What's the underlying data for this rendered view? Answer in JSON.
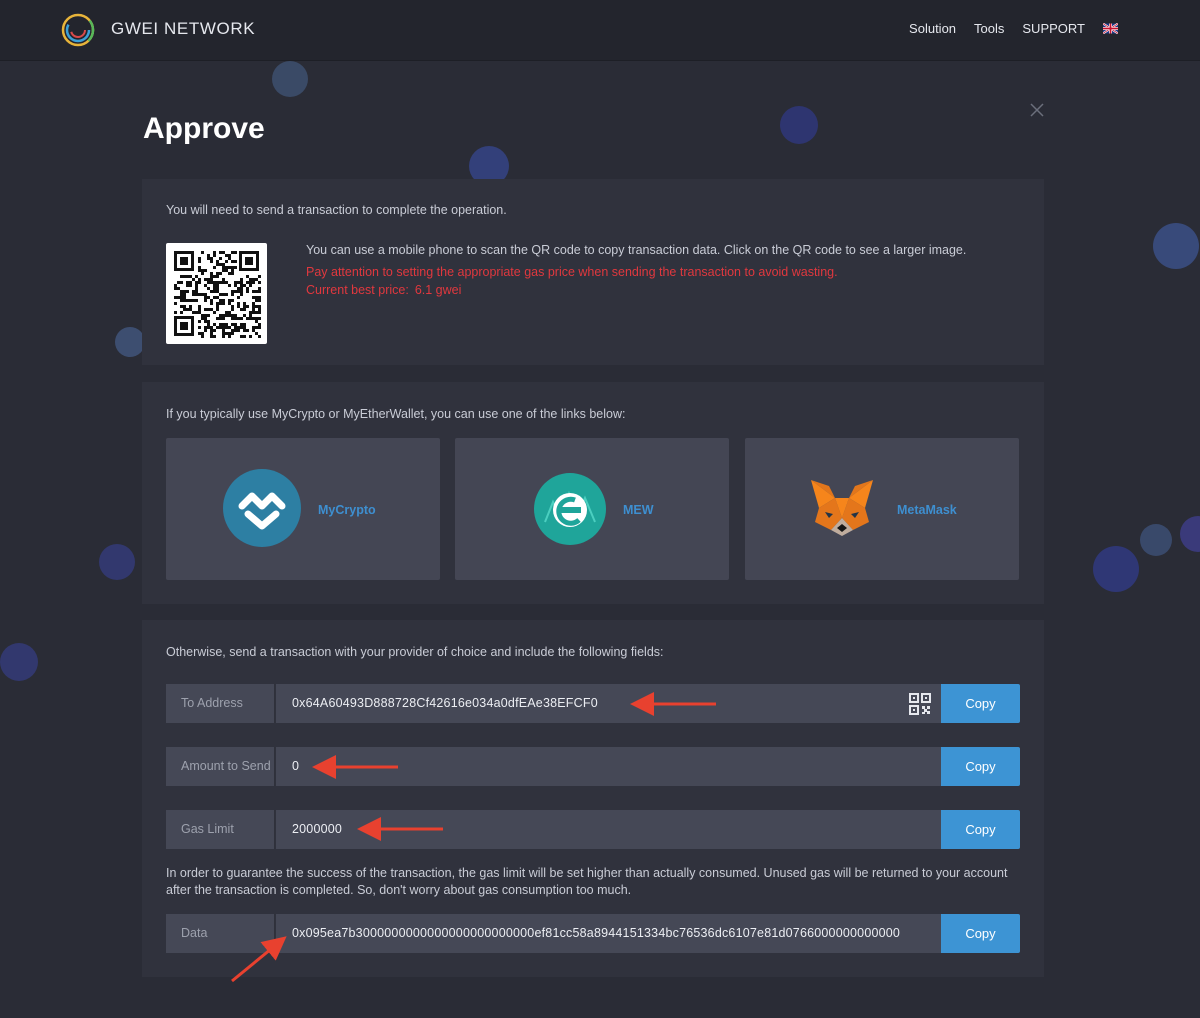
{
  "header": {
    "brand": "GWEI NETWORK",
    "nav": [
      "Solution",
      "Tools",
      "SUPPORT"
    ],
    "language_icon": "uk-flag-icon"
  },
  "modal": {
    "title": "Approve",
    "close_icon": "close-icon"
  },
  "qr_section": {
    "intro": "You will need to send a transaction to complete the operation.",
    "scan_hint": "You can use a mobile phone to scan the QR code to copy transaction data. Click on the QR code to see a larger image.",
    "warning": "Pay attention to setting the appropriate gas price when sending the transaction to avoid wasting.",
    "price_label": "Current best price:",
    "price_value": "6.1 gwei"
  },
  "wallets_section": {
    "intro": "If you typically use MyCrypto or MyEtherWallet, you can use one of the links below:",
    "wallets": [
      {
        "label": "MyCrypto",
        "icon": "mycrypto-logo-icon"
      },
      {
        "label": "MEW",
        "icon": "mew-logo-icon"
      },
      {
        "label": "MetaMask",
        "icon": "metamask-fox-icon"
      }
    ]
  },
  "fields_section": {
    "intro": "Otherwise, send a transaction with your provider of choice and include the following fields:",
    "fields": [
      {
        "label": "To Address",
        "value": "0x64A60493D888728Cf42616e034a0dfEAe38EFCF0",
        "copy": "Copy"
      },
      {
        "label": "Amount to Send",
        "value": "0",
        "copy": "Copy"
      },
      {
        "label": "Gas Limit",
        "value": "2000000",
        "copy": "Copy"
      },
      {
        "label": "Data",
        "value": "0x095ea7b3000000000000000000000000ef81cc58a8944151334bc76536dc6107e81d0766000000000000",
        "copy": "Copy"
      }
    ],
    "gas_note": "In order to guarantee the success of the transaction, the gas limit will be set higher than actually consumed. Unused gas will be returned to your account after the transaction is completed. So, don't worry about gas consumption too much."
  },
  "colors": {
    "background": "#2a2c36",
    "panel": "#30323d",
    "accent": "#3d94d4",
    "warning": "#e0383e",
    "annotation_arrow": "#e8412f"
  }
}
